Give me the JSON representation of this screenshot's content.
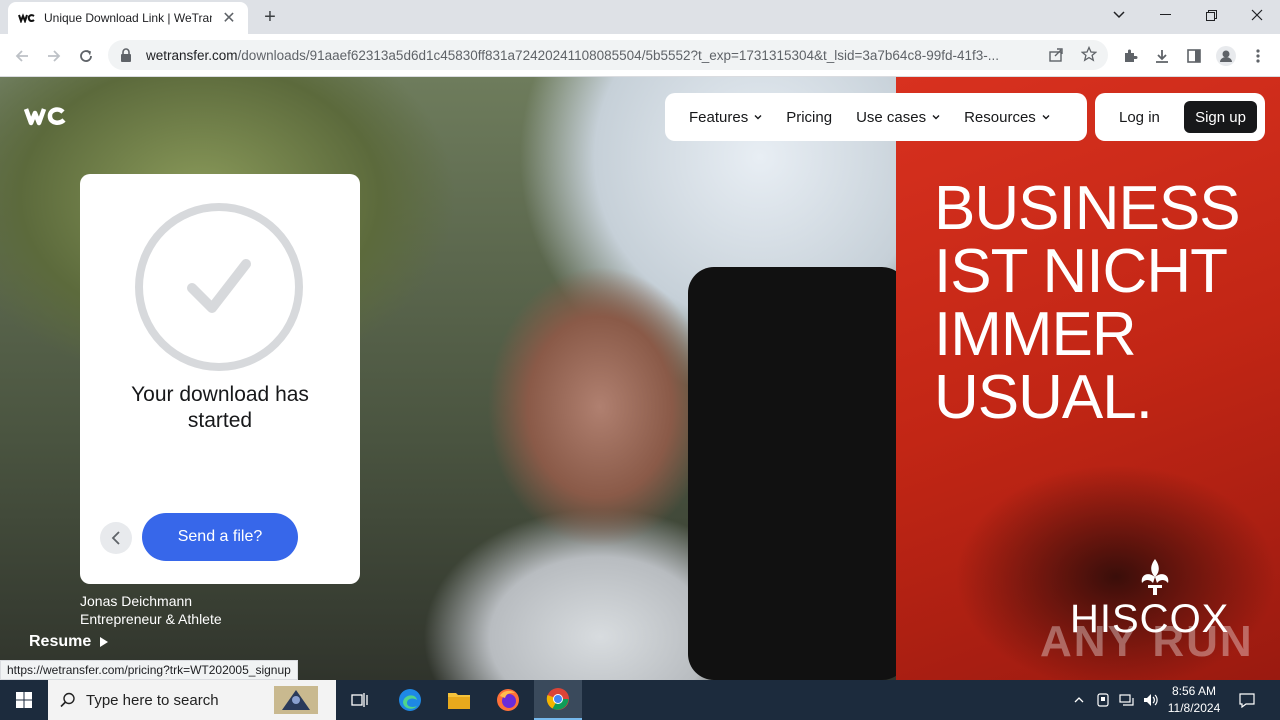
{
  "browser": {
    "tab_title": "Unique Download Link | WeTransfer",
    "new_tab_label": "+",
    "url_host": "wetransfer.com",
    "url_path": "/downloads/91aaef62313a5d6d1c45830ff831a72420241108085504/5b5552?t_exp=1731315304&t_lsid=3a7b64c8-99fd-41f3-...",
    "status_url": "https://wetransfer.com/pricing?trk=WT202005_signup"
  },
  "nav": {
    "items": [
      {
        "label": "Features",
        "has_dropdown": true
      },
      {
        "label": "Pricing",
        "has_dropdown": false
      },
      {
        "label": "Use cases",
        "has_dropdown": true
      },
      {
        "label": "Resources",
        "has_dropdown": true
      }
    ],
    "login_label": "Log in",
    "signup_label": "Sign up"
  },
  "card": {
    "title": "Your download has started",
    "send_label": "Send a file?"
  },
  "caption": {
    "name": "Jonas Deichmann",
    "role": "Entrepreneur & Athlete",
    "resume_label": "Resume"
  },
  "ad": {
    "headline_lines": [
      "BUSINESS",
      "IST NICHT",
      "IMMER",
      "USUAL."
    ],
    "brand": "HISCOX"
  },
  "watermark": "ANY RUN",
  "taskbar": {
    "search_placeholder": "Type here to search",
    "time": "8:56 AM",
    "date": "11/8/2024"
  },
  "colors": {
    "accent_blue": "#3767ea",
    "ad_red": "#c22615",
    "taskbar": "#1c2b3d"
  }
}
